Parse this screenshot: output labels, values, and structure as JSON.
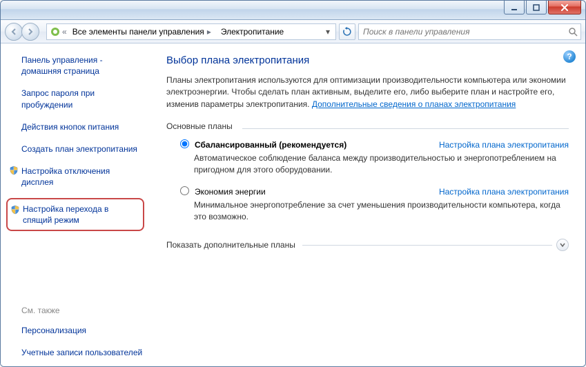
{
  "breadcrumb": {
    "seg1": "Все элементы панели управления",
    "seg2": "Электропитание"
  },
  "search": {
    "placeholder": "Поиск в панели управления"
  },
  "sidebar": {
    "home": "Панель управления - домашняя страница",
    "links": [
      "Запрос пароля при пробуждении",
      "Действия кнопок питания",
      "Создать план электропитания",
      "Настройка отключения дисплея",
      "Настройка перехода в спящий режим"
    ],
    "see_also_label": "См. также",
    "see_also": [
      "Персонализация",
      "Учетные записи пользователей"
    ]
  },
  "content": {
    "title": "Выбор плана электропитания",
    "description": "Планы электропитания используются для оптимизации производительности компьютера или экономии электроэнергии. Чтобы сделать план активным, выделите его, либо выберите план и настройте его, изменив параметры электропитания. ",
    "more_link": "Дополнительные сведения о планах электропитания",
    "section_main": "Основные планы",
    "plans": [
      {
        "name": "Сбалансированный (рекомендуется)",
        "desc": "Автоматическое соблюдение баланса между производительностью и энергопотреблением на пригодном для этого оборудовании.",
        "settings_link": "Настройка плана электропитания"
      },
      {
        "name": "Экономия энергии",
        "desc": "Минимальное энергопотребление за счет уменьшения производительности компьютера, когда это возможно.",
        "settings_link": "Настройка плана электропитания"
      }
    ],
    "show_more": "Показать дополнительные планы"
  }
}
